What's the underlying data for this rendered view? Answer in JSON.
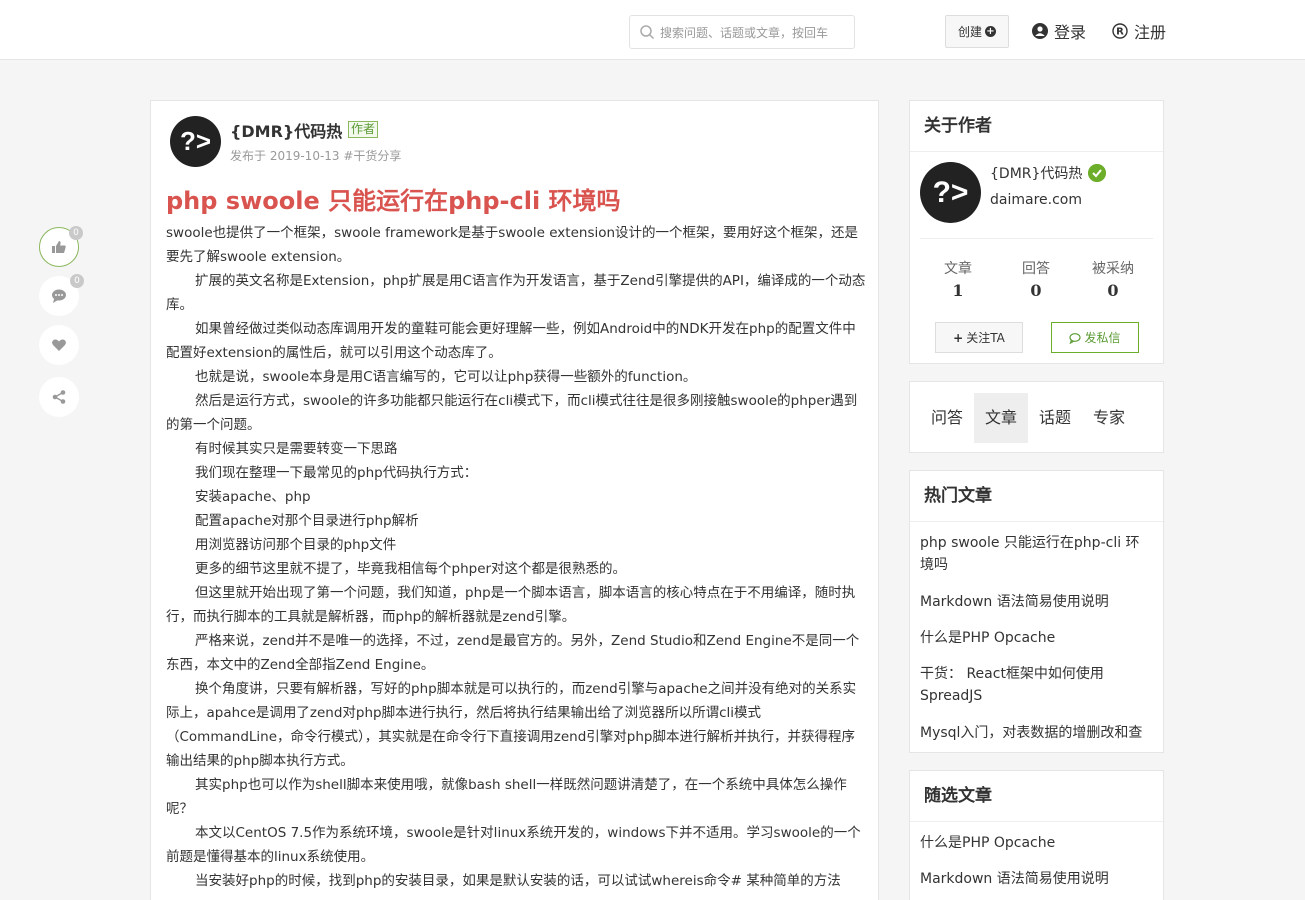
{
  "header": {
    "search_placeholder": "搜索问题、话题或文章，按回车",
    "create_label": "创建",
    "login_label": "登录",
    "register_label": "注册"
  },
  "side_actions": {
    "like_count": "0",
    "comment_count": "0"
  },
  "article": {
    "author_name": "{DMR}代码热",
    "author_tag": "作者",
    "meta": "发布于 2019-10-13 #干货分享",
    "title": "php swoole 只能运行在php-cli 环境吗",
    "paragraphs": [
      "swoole也提供了一个框架，swoole framework是基于swoole extension设计的一个框架，要用好这个框架，还是要先了解swoole extension。",
      "扩展的英文名称是Extension，php扩展是用C语言作为开发语言，基于Zend引擎提供的API，编译成的一个动态库。",
      "如果曾经做过类似动态库调用开发的童鞋可能会更好理解一些，例如Android中的NDK开发在php的配置文件中配置好extension的属性后，就可以引用这个动态库了。",
      "也就是说，swoole本身是用C语言编写的，它可以让php获得一些额外的function。",
      "然后是运行方式，swoole的许多功能都只能运行在cli模式下，而cli模式往往是很多刚接触swoole的phper遇到的第一个问题。",
      "有时候其实只是需要转变一下思路",
      "我们现在整理一下最常见的php代码执行方式：",
      "安装apache、php",
      "配置apache对那个目录进行php解析",
      "用浏览器访问那个目录的php文件",
      "更多的细节这里就不提了，毕竟我相信每个phper对这个都是很熟悉的。",
      "但这里就开始出现了第一个问题，我们知道，php是一个脚本语言，脚本语言的核心特点在于不用编译，随时执行，而执行脚本的工具就是解析器，而php的解析器就是zend引擎。",
      "严格来说，zend并不是唯一的选择，不过，zend是最官方的。另外，Zend Studio和Zend Engine不是同一个东西，本文中的Zend全部指Zend Engine。",
      "换个角度讲，只要有解析器，写好的php脚本就是可以执行的，而zend引擎与apache之间并没有绝对的关系实际上，apahce是调用了zend对php脚本进行执行，然后将执行结果输出给了浏览器所以所谓cli模式（CommandLine，命令行模式），其实就是在命令行下直接调用zend引擎对php脚本进行解析并执行，并获得程序输出结果的php脚本执行方式。",
      "其实php也可以作为shell脚本来使用哦，就像bash shell一样既然问题讲清楚了，在一个系统中具体怎么操作呢？",
      "本文以CentOS 7.5作为系统环境，swoole是针对linux系统开发的，windows下并不适用。学习swoole的一个前题是懂得基本的linux系统使用。",
      "当安装好php的时候，找到php的安装目录，如果是默认安装的话，可以试试whereis命令# 某种简单的方法"
    ]
  },
  "about": {
    "title": "关于作者",
    "name": "{DMR}代码热",
    "site": "daimare.com",
    "stats": [
      {
        "label": "文章",
        "value": "1"
      },
      {
        "label": "回答",
        "value": "0"
      },
      {
        "label": "被采纳",
        "value": "0"
      }
    ],
    "follow_label": "关注TA",
    "message_label": "发私信"
  },
  "tabs": [
    "问答",
    "文章",
    "话题",
    "专家"
  ],
  "hot": {
    "title": "热门文章",
    "items": [
      "php swoole 只能运行在php-cli 环境吗",
      "Markdown 语法简易使用说明",
      "什么是PHP Opcache",
      "干货： React框架中如何使用SpreadJS",
      "Mysql入门，对表数据的增删改和查"
    ]
  },
  "random": {
    "title": "随选文章",
    "items": [
      "什么是PHP Opcache",
      "Markdown 语法简易使用说明"
    ]
  },
  "colors": {
    "title_red": "#d9534f",
    "accent_green": "#6cae2a"
  }
}
